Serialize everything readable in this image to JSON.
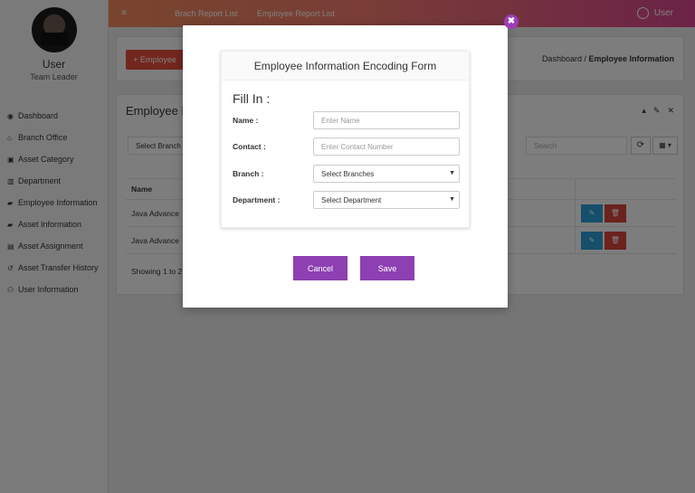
{
  "sidebar": {
    "user_name": "User",
    "user_role": "Team Leader",
    "items": [
      {
        "icon": "dashboard-icon",
        "glyph": "◉",
        "label": "Dashboard"
      },
      {
        "icon": "home-icon",
        "glyph": "⌂",
        "label": "Branch Office"
      },
      {
        "icon": "category-icon",
        "glyph": "▣",
        "label": "Asset Category"
      },
      {
        "icon": "building-icon",
        "glyph": "▥",
        "label": "Department"
      },
      {
        "icon": "folder-icon",
        "glyph": "▰",
        "label": "Employee Information"
      },
      {
        "icon": "folder-icon",
        "glyph": "▰",
        "label": "Asset Information"
      },
      {
        "icon": "list-icon",
        "glyph": "▤",
        "label": "Asset Assignment"
      },
      {
        "icon": "history-icon",
        "glyph": "↺",
        "label": "Asset Transfer History"
      },
      {
        "icon": "users-icon",
        "glyph": "⚇",
        "label": "User Information"
      }
    ]
  },
  "topbar": {
    "menu_glyph": "≡",
    "link1": "Brach Report List",
    "link2": "Employee Report List",
    "user_label": "User"
  },
  "header": {
    "add_button": "+ Employee",
    "breadcrumb_root": "Dashboard",
    "breadcrumb_sep": " / ",
    "breadcrumb_current": "Employee Information"
  },
  "card": {
    "title": "Employee I",
    "tools": [
      "▴",
      "✎",
      "✕"
    ],
    "select_branch": "Select Branch",
    "search_placeholder": "Search",
    "refresh_glyph": "⟳",
    "grid_glyph": "▦ ▾",
    "column_name": "Name",
    "rows": [
      {
        "name": "Java Advance"
      },
      {
        "name": "Java Advance"
      }
    ],
    "showing": "Showing 1 to 2",
    "edit_glyph": "✎",
    "delete_glyph": "🗑"
  },
  "modal": {
    "close_glyph": "✖",
    "form_title": "Employee Information Encoding Form",
    "fill_in": "Fill In :",
    "name_label": "Name :",
    "name_placeholder": "Enter Name",
    "contact_label": "Contact :",
    "contact_placeholder": "Enter Contact Number",
    "branch_label": "Branch :",
    "branch_value": "Select Branches",
    "department_label": "Department :",
    "department_value": "Select Department",
    "cancel": "Cancel",
    "save": "Save"
  },
  "colors": {
    "accent": "#8e3fb2",
    "topbar_start": "#f08a5a",
    "topbar_end": "#d8468f",
    "danger": "#e74c3c",
    "info": "#2a9fd6"
  }
}
